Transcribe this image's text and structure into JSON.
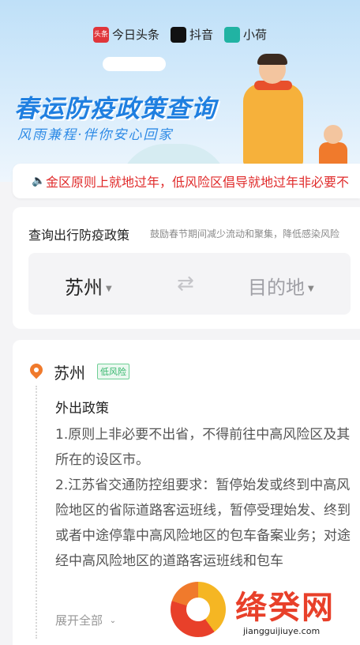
{
  "header": {
    "partners": [
      "今日头条",
      "抖音",
      "小荷"
    ],
    "badge_text": "头条",
    "title": "春运防疫政策查询",
    "subtitle": "风雨兼程·伴你安心回家"
  },
  "notice": {
    "text": "金区原则上就地过年，低风险区倡导就地过年非必要不"
  },
  "query": {
    "heading": "查询出行防疫政策",
    "hint": "鼓励春节期间减少流动和聚集，降低感染风险",
    "from_city": "苏州",
    "to_placeholder": "目的地",
    "swap_glyph": "⇄"
  },
  "policy": {
    "city": "苏州",
    "risk_level": "低风险",
    "section_title": "外出政策",
    "paragraphs": [
      "1.原则上非必要不出省，不得前往中高风险区及其所在的设区市。",
      "2.江苏省交通防控组要求：暂停始发或终到中高风险地区的省际道路客运班线，暂停受理始发、终到或者中途停靠中高风险地区的包车备案业务；对途经中高风险地区的道路客运班线和包车"
    ],
    "expand_label": "展开全部"
  },
  "watermark": {
    "text": "绛癸网",
    "url": "jiangguijiuye.com"
  },
  "colors": {
    "accent_blue": "#1f7fe0",
    "alert_red": "#e02b2b",
    "low_risk_green": "#32b56a"
  },
  "icons": [
    "speaker-icon",
    "location-pin-icon",
    "chevron-down-icon",
    "swap-icon"
  ]
}
